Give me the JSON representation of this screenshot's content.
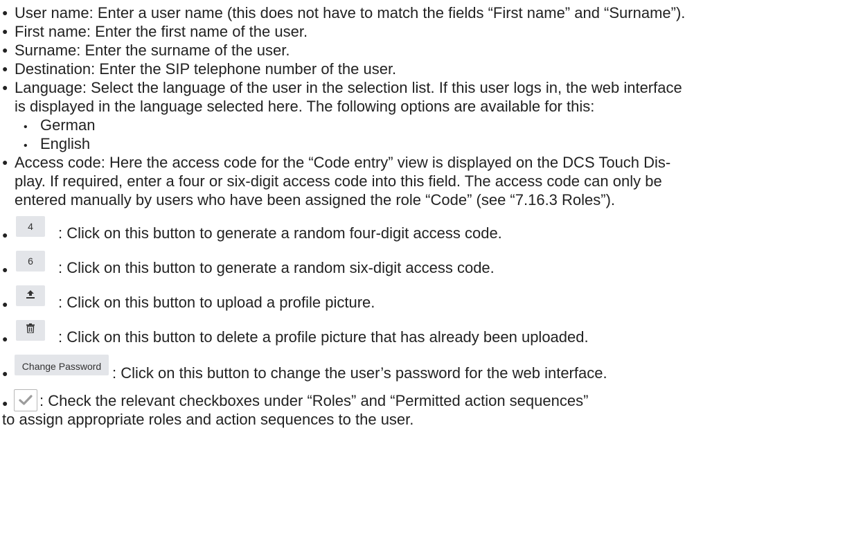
{
  "fields": [
    {
      "text": "User name: Enter a user name (this does not have to match the fields “First name” and “Surname”)."
    },
    {
      "text": "First name: Enter the first name of the user."
    },
    {
      "text": "Surname: Enter the surname of the user."
    },
    {
      "text": "Destination: Enter the SIP telephone number of the user."
    }
  ],
  "language": {
    "lines": [
      "Language: Select the language of the user in the selection list. If this user logs in, the web interface",
      "is displayed in the language selected here. The following options are available for this:"
    ],
    "options": [
      "German",
      "English"
    ]
  },
  "access_code": {
    "lines": [
      "Access code: Here the access code for the “Code entry” view is displayed on the DCS Touch Dis-",
      "play. If required, enter a four or six-digit access code into this field. The access code can only be",
      "entered manually by users who have been assigned the role “Code” (see “7.16.3 Roles”)."
    ]
  },
  "buttons": [
    {
      "label": "4",
      "description": ": Click on this button to generate a random four-digit access code."
    },
    {
      "label": "6",
      "description": ": Click on this button to generate a random six-digit access code."
    },
    {
      "icon": "upload-icon",
      "description": ": Click on this button to upload a profile picture."
    },
    {
      "icon": "trash-icon",
      "description": ": Click on this button to delete a profile picture that has already been uploaded."
    },
    {
      "label": "Change Password",
      "description": ": Click on this button to change the user’s password for the web interface."
    },
    {
      "icon": "checkmark-icon",
      "description": ": Check the relevant checkboxes under “Roles” and “Permitted action sequences”",
      "continuation": "to assign appropriate roles and action sequences to the user."
    }
  ],
  "bullet_glyph": "●",
  "sub_bullet_glyph": "•"
}
